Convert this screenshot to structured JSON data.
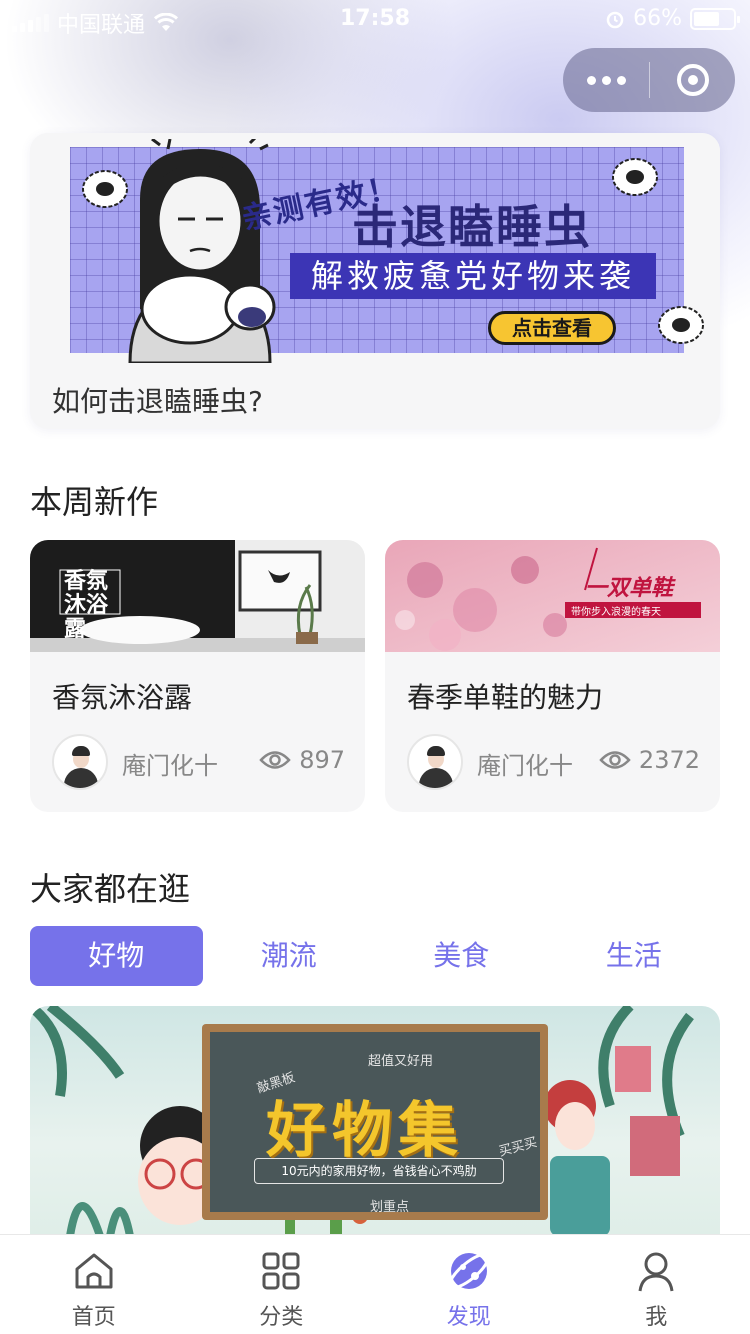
{
  "status_bar": {
    "carrier": "中国联通",
    "time": "17:58",
    "battery": "66%",
    "battery_level": 0.66
  },
  "capsule": {
    "more_icon": "more-dots-icon",
    "close_icon": "target-icon"
  },
  "featured": {
    "banner": {
      "tag": "亲测有效！",
      "title": "击退瞌睡虫",
      "subtitle": "解救疲惫党好物来袭",
      "button": "点击查看"
    },
    "caption": "如何击退瞌睡虫?"
  },
  "new_this_week": {
    "title": "本周新作",
    "cards": [
      {
        "thumb_text": "香氛沐浴露",
        "title": "香氛沐浴露",
        "author": "庵门化十",
        "views": "897"
      },
      {
        "thumb_title": "一双单鞋",
        "thumb_sub": "带你步入浪漫的春天",
        "title": "春季单鞋的魅力",
        "author": "庵门化十",
        "views": "2372"
      }
    ]
  },
  "browse": {
    "title": "大家都在逛",
    "tabs": [
      "好物",
      "潮流",
      "美食",
      "生活"
    ],
    "active_tab": 0,
    "banner": {
      "top": "超值又好用",
      "left": "敲黑板",
      "title": "好物集",
      "right": "买买买",
      "desc": "10元内的家用好物，省钱省心不鸡肋",
      "bottom": "划重点"
    }
  },
  "tabbar": {
    "items": [
      {
        "label": "首页",
        "icon": "home-icon"
      },
      {
        "label": "分类",
        "icon": "grid-icon"
      },
      {
        "label": "发现",
        "icon": "discover-icon"
      },
      {
        "label": "我",
        "icon": "user-icon"
      }
    ],
    "active": 2
  },
  "colors": {
    "accent": "#7672ea"
  }
}
